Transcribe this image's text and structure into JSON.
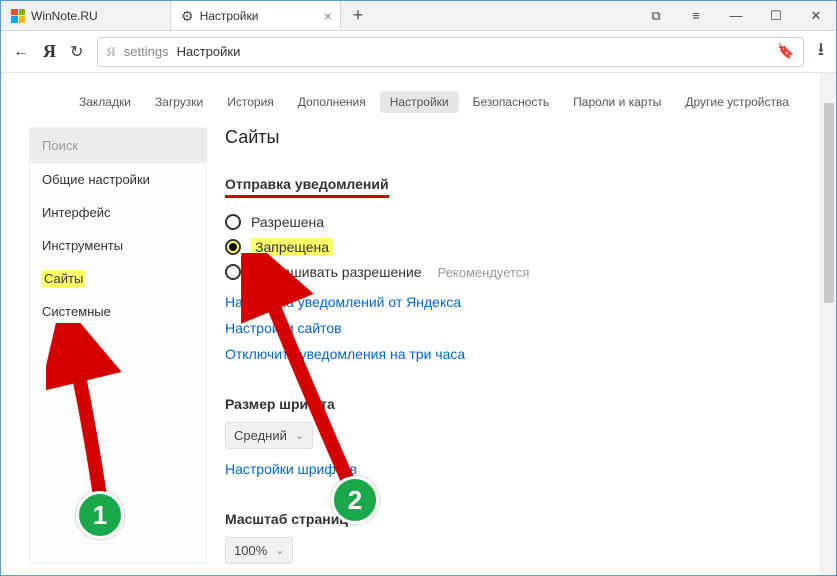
{
  "tabs": [
    {
      "title": "WinNote.RU"
    },
    {
      "title": "Настройки"
    }
  ],
  "omnibox": {
    "prefix": "settings",
    "text": "Настройки"
  },
  "topnav": {
    "items": [
      "Закладки",
      "Загрузки",
      "История",
      "Дополнения",
      "Настройки",
      "Безопасность",
      "Пароли и карты",
      "Другие устройства"
    ],
    "active_index": 4
  },
  "sidebar": {
    "search_placeholder": "Поиск",
    "items": [
      "Общие настройки",
      "Интерфейс",
      "Инструменты",
      "Сайты",
      "Системные"
    ],
    "highlight_index": 3
  },
  "panel": {
    "heading": "Сайты",
    "notifications": {
      "title": "Отправка уведомлений",
      "options": [
        {
          "label": "Разрешена",
          "selected": false
        },
        {
          "label": "Запрещена",
          "selected": true
        },
        {
          "label": "Запрашивать разрешение",
          "selected": false,
          "recommended": "Рекомендуется"
        }
      ],
      "links": [
        "Настройка уведомлений от Яндекса",
        "Настройки сайтов",
        "Отключить уведомления на три часа"
      ]
    },
    "font": {
      "title": "Размер шрифта",
      "value": "Средний",
      "link": "Настройки шрифтов"
    },
    "zoom": {
      "title": "Масштаб страниц",
      "value": "100%"
    }
  },
  "annotations": {
    "badge1": "1",
    "badge2": "2"
  }
}
